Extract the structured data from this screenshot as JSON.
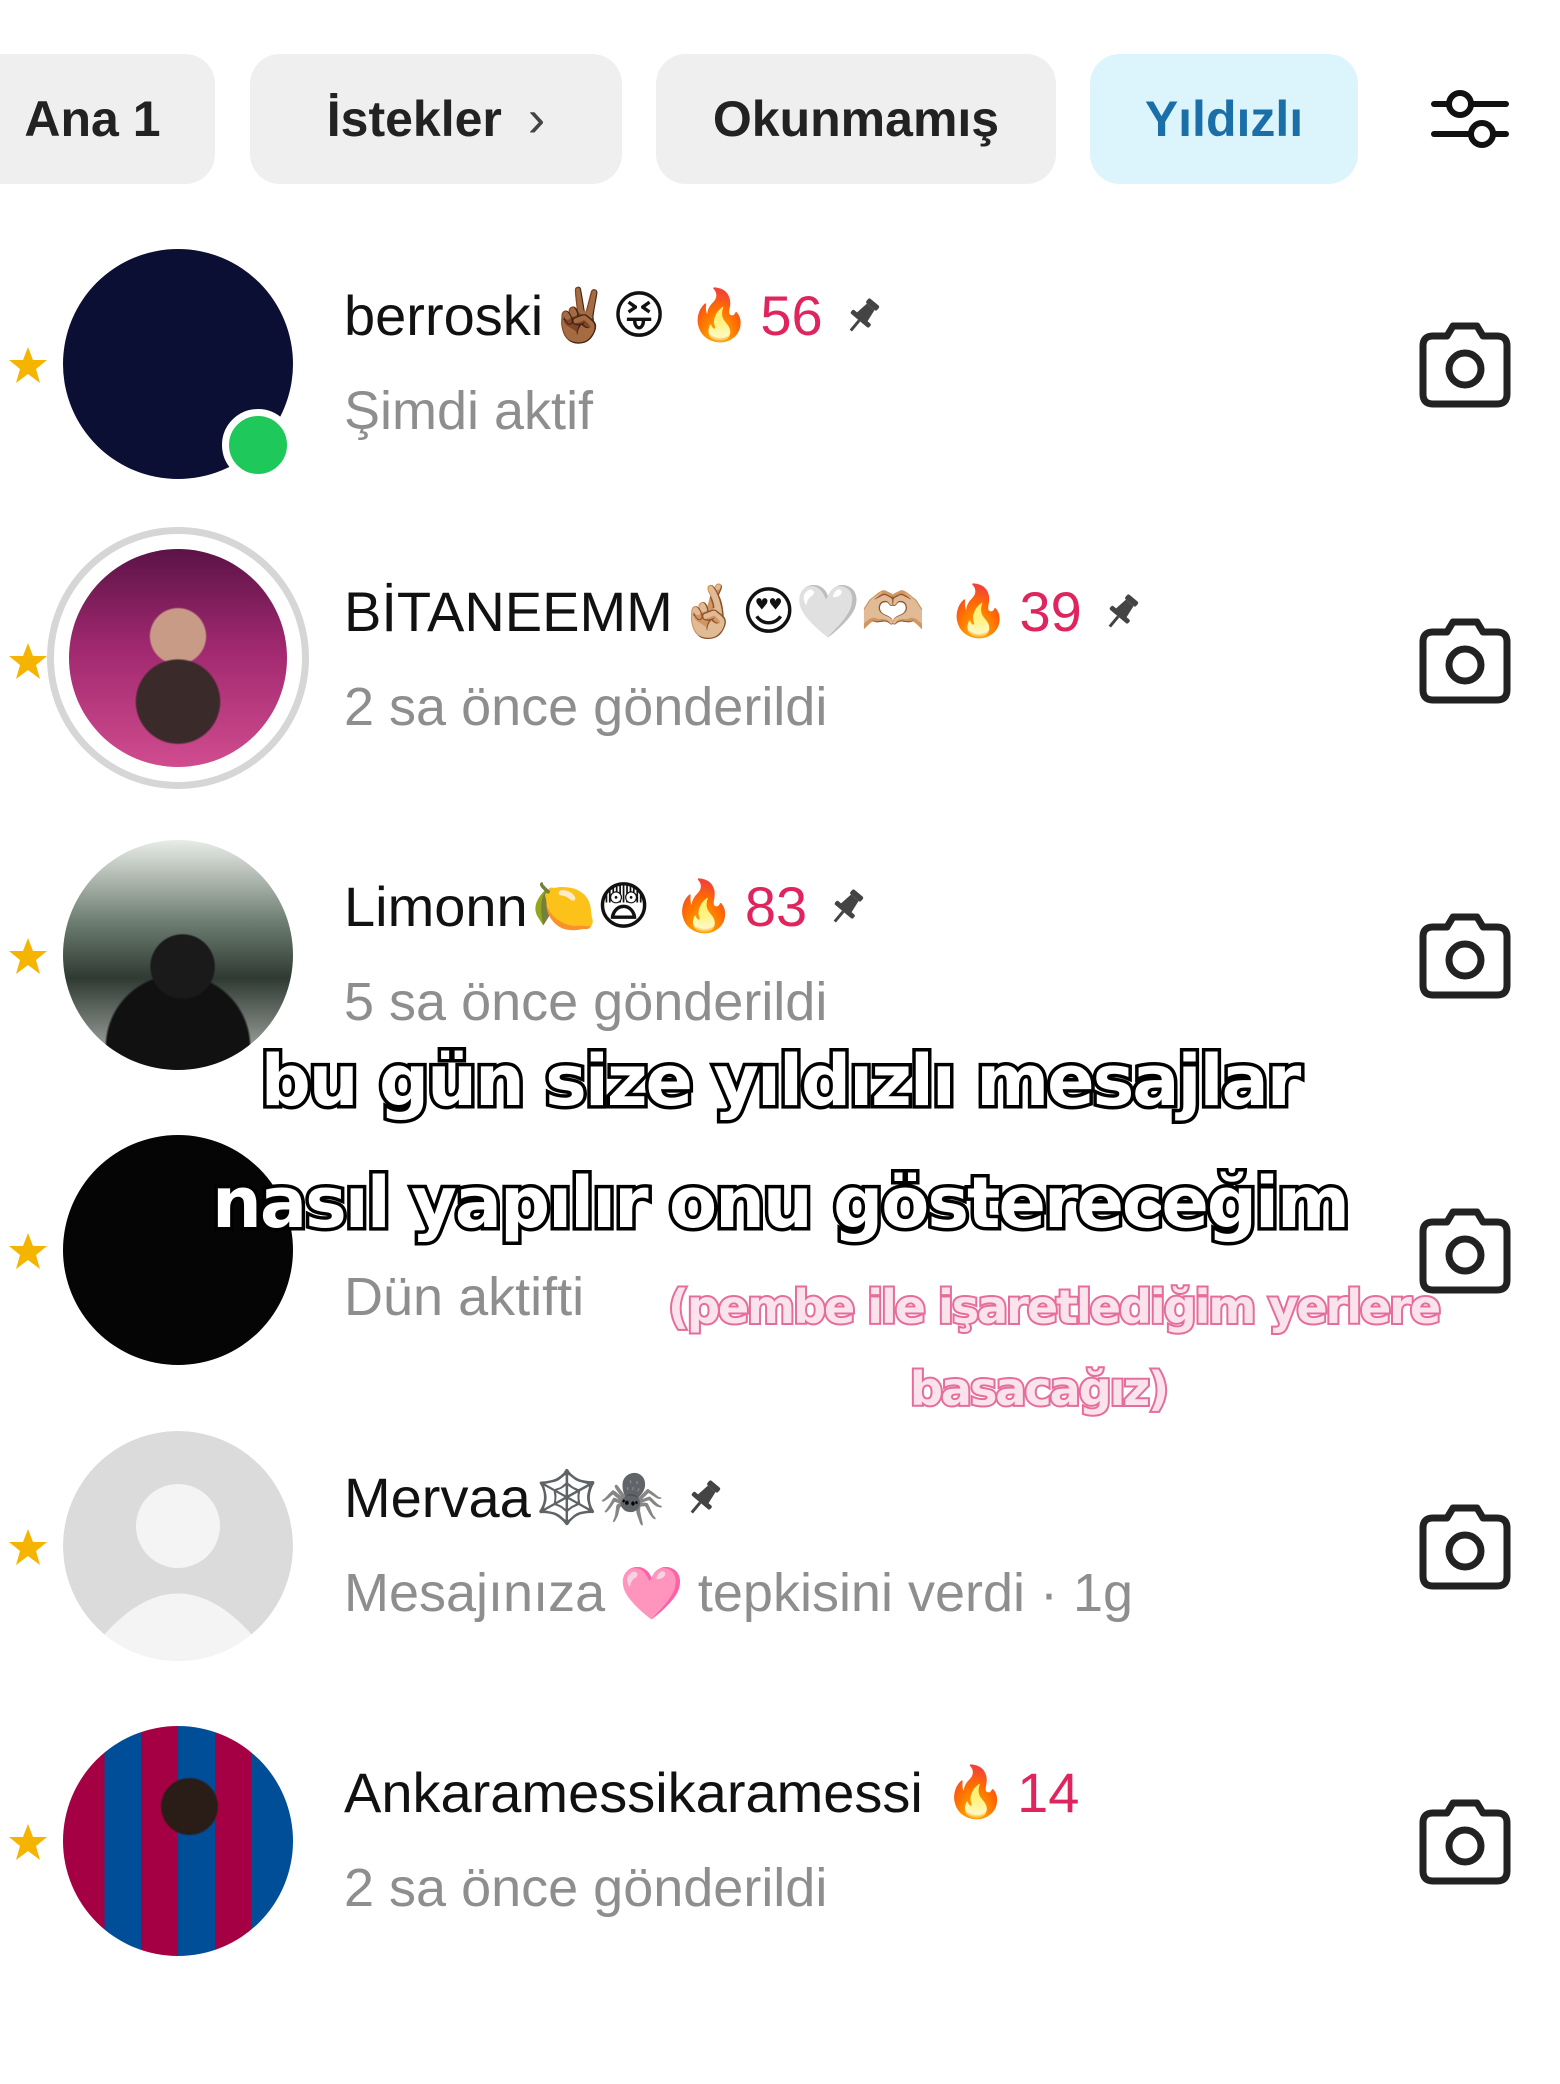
{
  "tabs": [
    {
      "label": "Ana 1",
      "active": false,
      "chevron": false
    },
    {
      "label": "İstekler",
      "active": false,
      "chevron": true
    },
    {
      "label": "Okunmamış",
      "active": false,
      "chevron": false
    },
    {
      "label": "Yıldızlı",
      "active": true,
      "chevron": false
    }
  ],
  "tab_chevron": "›",
  "filter_icon": "sliders-icon",
  "conversations": [
    {
      "name": "berroski",
      "emojis": "✌🏾😝",
      "streak": "56",
      "pinned": true,
      "status": "Şimdi aktif",
      "online": true,
      "starred": true,
      "avatar": "dark-navy"
    },
    {
      "name": "BİTANEEMM",
      "emojis": "🤞🏼😍🤍🫶🏼",
      "streak": "39",
      "pinned": true,
      "status": "2 sa önce gönderildi",
      "online": false,
      "starred": true,
      "avatar": "story-ring-photo"
    },
    {
      "name": "Limonn",
      "emojis": "🍋😨",
      "streak": "83",
      "pinned": true,
      "status": "5 sa önce gönderildi",
      "online": false,
      "starred": true,
      "avatar": "photo"
    },
    {
      "name": "",
      "emojis": "",
      "streak": "",
      "pinned": false,
      "status": "Dün aktifti",
      "online": false,
      "starred": true,
      "avatar": "black"
    },
    {
      "name": "Mervaa",
      "emojis": "🕸️🕷️",
      "streak": "",
      "pinned": true,
      "status_prefix": "Mesajınıza",
      "status_emoji": "🩷",
      "status": "tepkisini verdi · 1g",
      "online": false,
      "starred": true,
      "avatar": "default"
    },
    {
      "name": "Ankaramessikaramessi",
      "emojis": "",
      "streak": "14",
      "pinned": false,
      "status": "2 sa önce gönderildi",
      "online": false,
      "starred": true,
      "avatar": "messi-photo"
    }
  ],
  "fire_emoji": "🔥",
  "overlay": {
    "line1": "bu gün size yıldızlı mesajlar",
    "line2": "nasıl yapılır onu göstereceğim",
    "pink1": "(pembe ile işaretlediğim yerlere",
    "pink2": "basacağız)"
  },
  "colors": {
    "active_tab_bg": "#dcf4fb",
    "active_tab_text": "#1b6fa8",
    "streak": "#e0245e",
    "star": "#f5b400",
    "online": "#1fc85b",
    "pink_caption": "#e56c9b"
  }
}
